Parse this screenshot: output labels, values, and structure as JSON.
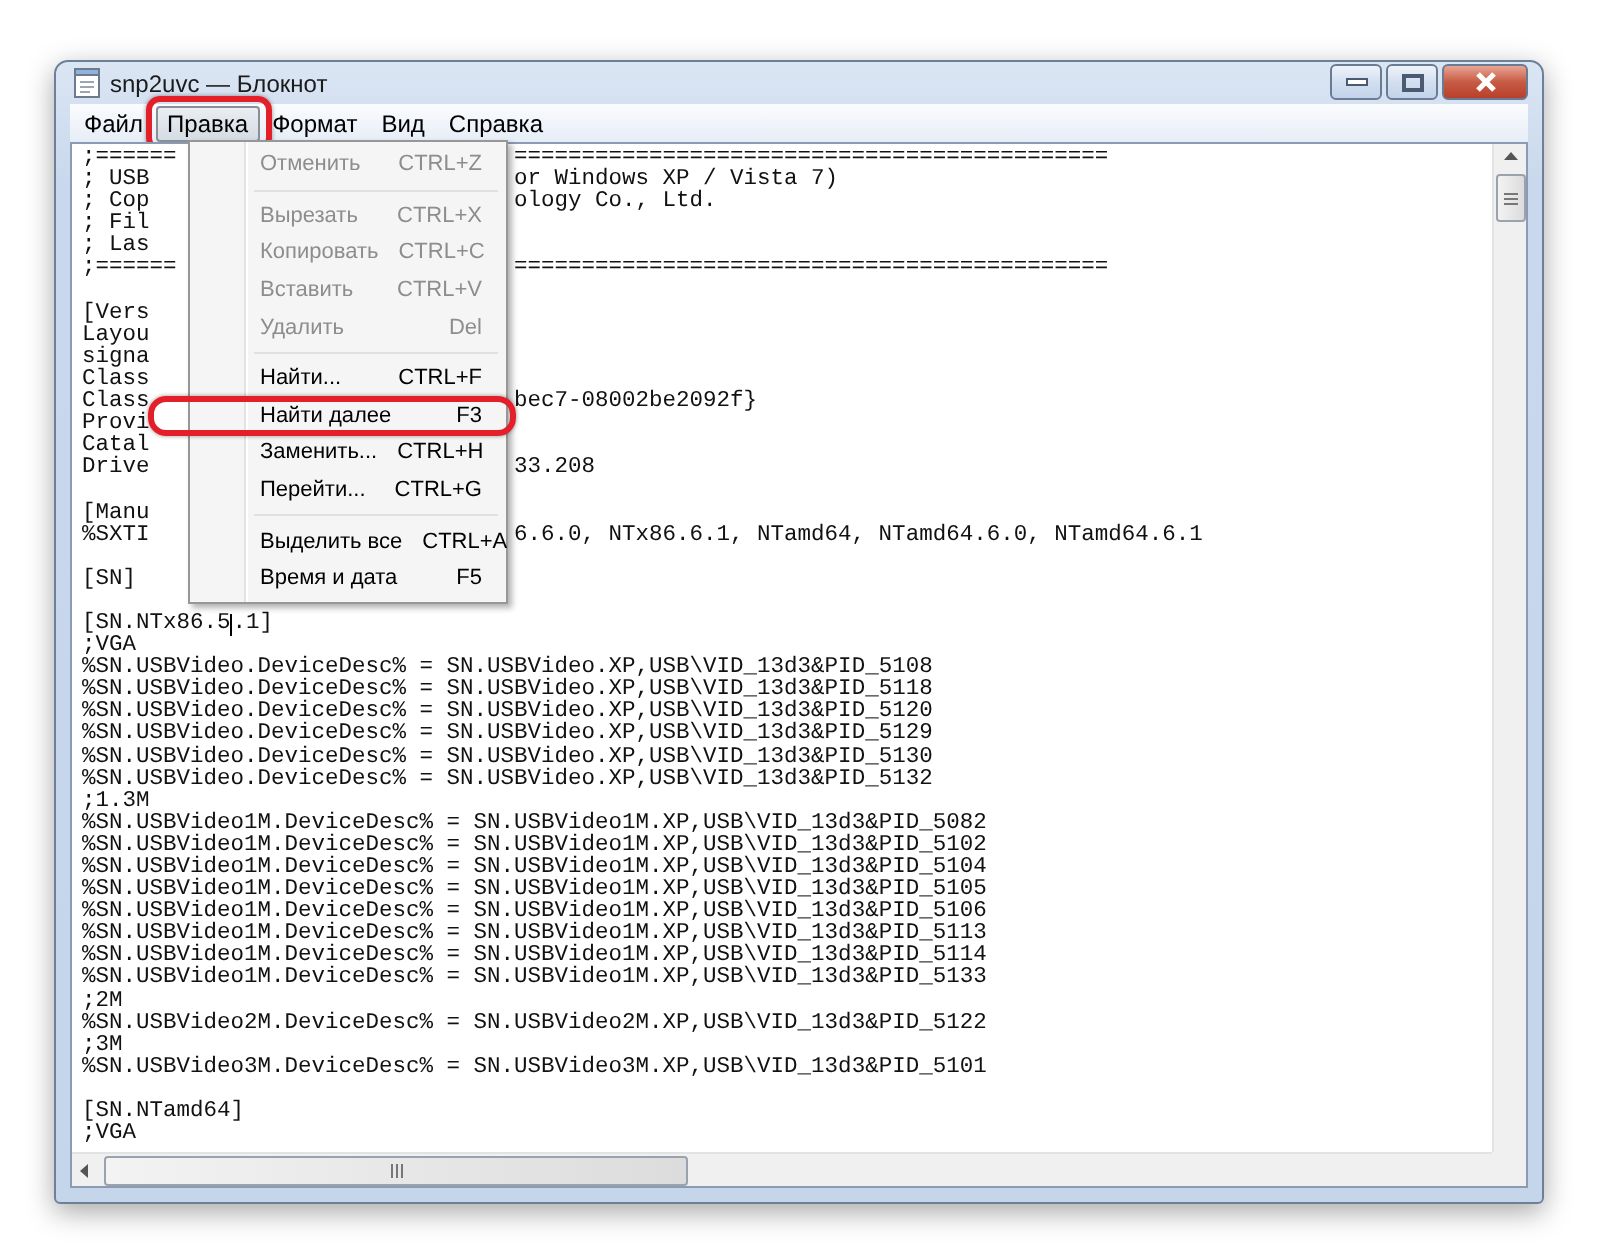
{
  "window": {
    "title": "snp2uvc — Блокнот"
  },
  "menu_bar": [
    {
      "label": "Файл",
      "selected": false,
      "circled": false
    },
    {
      "label": "Правка",
      "selected": true,
      "circled": true
    },
    {
      "label": "Формат",
      "selected": false,
      "circled": false
    },
    {
      "label": "Вид",
      "selected": false,
      "circled": false
    },
    {
      "label": "Справка",
      "selected": false,
      "circled": false
    }
  ],
  "edit_menu": [
    {
      "kind": "item",
      "label": "Отменить",
      "shortcut": "CTRL+Z",
      "disabled": true,
      "circled": false
    },
    {
      "kind": "separator"
    },
    {
      "kind": "item",
      "label": "Вырезать",
      "shortcut": "CTRL+X",
      "disabled": true,
      "circled": false
    },
    {
      "kind": "item",
      "label": "Копировать",
      "shortcut": "CTRL+C",
      "disabled": true,
      "circled": false
    },
    {
      "kind": "item",
      "label": "Вставить",
      "shortcut": "CTRL+V",
      "disabled": true,
      "circled": false
    },
    {
      "kind": "item",
      "label": "Удалить",
      "shortcut": "Del",
      "disabled": true,
      "circled": false
    },
    {
      "kind": "separator"
    },
    {
      "kind": "item",
      "label": "Найти...",
      "shortcut": "CTRL+F",
      "disabled": false,
      "circled": false
    },
    {
      "kind": "item",
      "label": "Найти далее",
      "shortcut": "F3",
      "disabled": false,
      "circled": true
    },
    {
      "kind": "item",
      "label": "Заменить...",
      "shortcut": "CTRL+H",
      "disabled": false,
      "circled": false
    },
    {
      "kind": "item",
      "label": "Перейти...",
      "shortcut": "CTRL+G",
      "disabled": false,
      "circled": false
    },
    {
      "kind": "separator"
    },
    {
      "kind": "item",
      "label": "Выделить все",
      "shortcut": "CTRL+A",
      "disabled": false,
      "circled": false
    },
    {
      "kind": "item",
      "label": "Время и дата",
      "shortcut": "F5",
      "disabled": false,
      "circled": false
    }
  ],
  "editor_blocks": [
    {
      "lines": [
        {
          "text": ";======",
          "tail": "============================================"
        },
        {
          "text": "; USB",
          "tail": "or Windows XP / Vista 7)"
        },
        {
          "text": "; Cop",
          "tail": "ology Co., Ltd."
        },
        {
          "text": "; Fil"
        },
        {
          "text": "; Las"
        },
        {
          "text": ";======",
          "tail": "============================================"
        }
      ]
    },
    {
      "lines": [
        {
          "text": "[Vers"
        },
        {
          "text": "Layou"
        },
        {
          "text": "signa"
        },
        {
          "text": "Class"
        },
        {
          "text": "Class",
          "tail": "bec7-08002be2092f}"
        },
        {
          "text": "Provi"
        },
        {
          "text": "Catal"
        },
        {
          "text": "Drive",
          "tail": "33.208"
        }
      ]
    },
    {
      "lines": [
        {
          "text": "[Manu"
        },
        {
          "text": "%SXTI",
          "tail": "6.6.0, NTx86.6.1, NTamd64, NTamd64.6.0, NTamd64.6.1"
        }
      ]
    },
    {
      "lines": [
        {
          "text": "[SN]"
        }
      ]
    },
    {
      "lines": [
        {
          "text": "[SN.NTx86.5",
          "after_caret": ".1]"
        },
        {
          "text": ";VGA"
        },
        {
          "text": "%SN.USBVideo.DeviceDesc% = SN.USBVideo.XP,USB\\VID_13d3&PID_5108"
        },
        {
          "text": "%SN.USBVideo.DeviceDesc% = SN.USBVideo.XP,USB\\VID_13d3&PID_5118"
        },
        {
          "text": "%SN.USBVideo.DeviceDesc% = SN.USBVideo.XP,USB\\VID_13d3&PID_5120"
        },
        {
          "text": "%SN.USBVideo.DeviceDesc% = SN.USBVideo.XP,USB\\VID_13d3&PID_5129"
        },
        {
          "text": "%SN.USBVideo.DeviceDesc% = SN.USBVideo.XP,USB\\VID_13d3&PID_5130"
        },
        {
          "text": "%SN.USBVideo.DeviceDesc% = SN.USBVideo.XP,USB\\VID_13d3&PID_5132"
        },
        {
          "text": ";1.3M"
        },
        {
          "text": "%SN.USBVideo1M.DeviceDesc% = SN.USBVideo1M.XP,USB\\VID_13d3&PID_5082"
        },
        {
          "text": "%SN.USBVideo1M.DeviceDesc% = SN.USBVideo1M.XP,USB\\VID_13d3&PID_5102"
        },
        {
          "text": "%SN.USBVideo1M.DeviceDesc% = SN.USBVideo1M.XP,USB\\VID_13d3&PID_5104"
        },
        {
          "text": "%SN.USBVideo1M.DeviceDesc% = SN.USBVideo1M.XP,USB\\VID_13d3&PID_5105"
        },
        {
          "text": "%SN.USBVideo1M.DeviceDesc% = SN.USBVideo1M.XP,USB\\VID_13d3&PID_5106"
        },
        {
          "text": "%SN.USBVideo1M.DeviceDesc% = SN.USBVideo1M.XP,USB\\VID_13d3&PID_5113"
        },
        {
          "text": "%SN.USBVideo1M.DeviceDesc% = SN.USBVideo1M.XP,USB\\VID_13d3&PID_5114"
        },
        {
          "text": "%SN.USBVideo1M.DeviceDesc% = SN.USBVideo1M.XP,USB\\VID_13d3&PID_5133"
        },
        {
          "text": ";2M"
        },
        {
          "text": "%SN.USBVideo2M.DeviceDesc% = SN.USBVideo2M.XP,USB\\VID_13d3&PID_5122"
        },
        {
          "text": ";3M"
        },
        {
          "text": "%SN.USBVideo3M.DeviceDesc% = SN.USBVideo3M.XP,USB\\VID_13d3&PID_5101"
        }
      ]
    },
    {
      "lines": [
        {
          "text": "[SN.NTamd64]"
        },
        {
          "text": ";VGA"
        }
      ]
    }
  ]
}
